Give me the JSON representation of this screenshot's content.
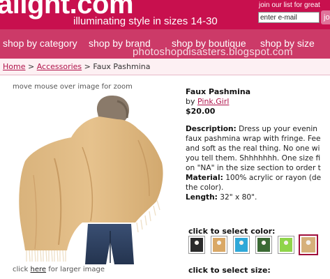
{
  "header": {
    "logo": "allgnt.com",
    "tagline": "illuminating style in sizes 14-30",
    "join_text": "join our list for great",
    "email_placeholder": "enter e-mail",
    "join_button": "jo",
    "brand_color": "#c8104e"
  },
  "nav": {
    "items": [
      "shop by category",
      "shop by brand",
      "shop by boutique",
      "shop by size"
    ],
    "watermark": "photoshopdisasters.blogspot.com",
    "color": "#cc3a68"
  },
  "breadcrumb": {
    "items": [
      "Home",
      "Accessories",
      "Faux Pashmina"
    ],
    "separator": ">"
  },
  "gallery": {
    "zoom_hint": "move mouse over image for zoom",
    "larger_prefix": "click",
    "larger_link": "here",
    "larger_suffix": "for larger image"
  },
  "product": {
    "title": "Faux Pashmina",
    "by": "by",
    "brand": "Pink.Girl",
    "price": "$20.00",
    "description_label": "Description:",
    "description_lines": [
      "Dress up your evenin",
      "faux pashmina wrap with fringe. Fee",
      "and soft as the real thing. No one wi",
      "you tell them. Shhhhhhh. One size fi",
      "on \"NA\" in the size section to order t"
    ],
    "material_label": "Material:",
    "material_lines": [
      "100% acrylic or rayon (de",
      "the color)."
    ],
    "length_label": "Length:",
    "length_value": "32\" x 80\"."
  },
  "options": {
    "color_label": "click to select color:",
    "swatches": [
      {
        "name": "black",
        "color": "#2b2b2b",
        "selected": false
      },
      {
        "name": "camel",
        "color": "#d9a866",
        "selected": false
      },
      {
        "name": "turquoise",
        "color": "#2fa8d8",
        "selected": false
      },
      {
        "name": "green",
        "color": "#3b6a34",
        "selected": false
      },
      {
        "name": "lime",
        "color": "#8fd44a",
        "selected": false
      },
      {
        "name": "tan",
        "color": "#d6b07a",
        "selected": true
      }
    ],
    "size_label": "click to select size:"
  }
}
